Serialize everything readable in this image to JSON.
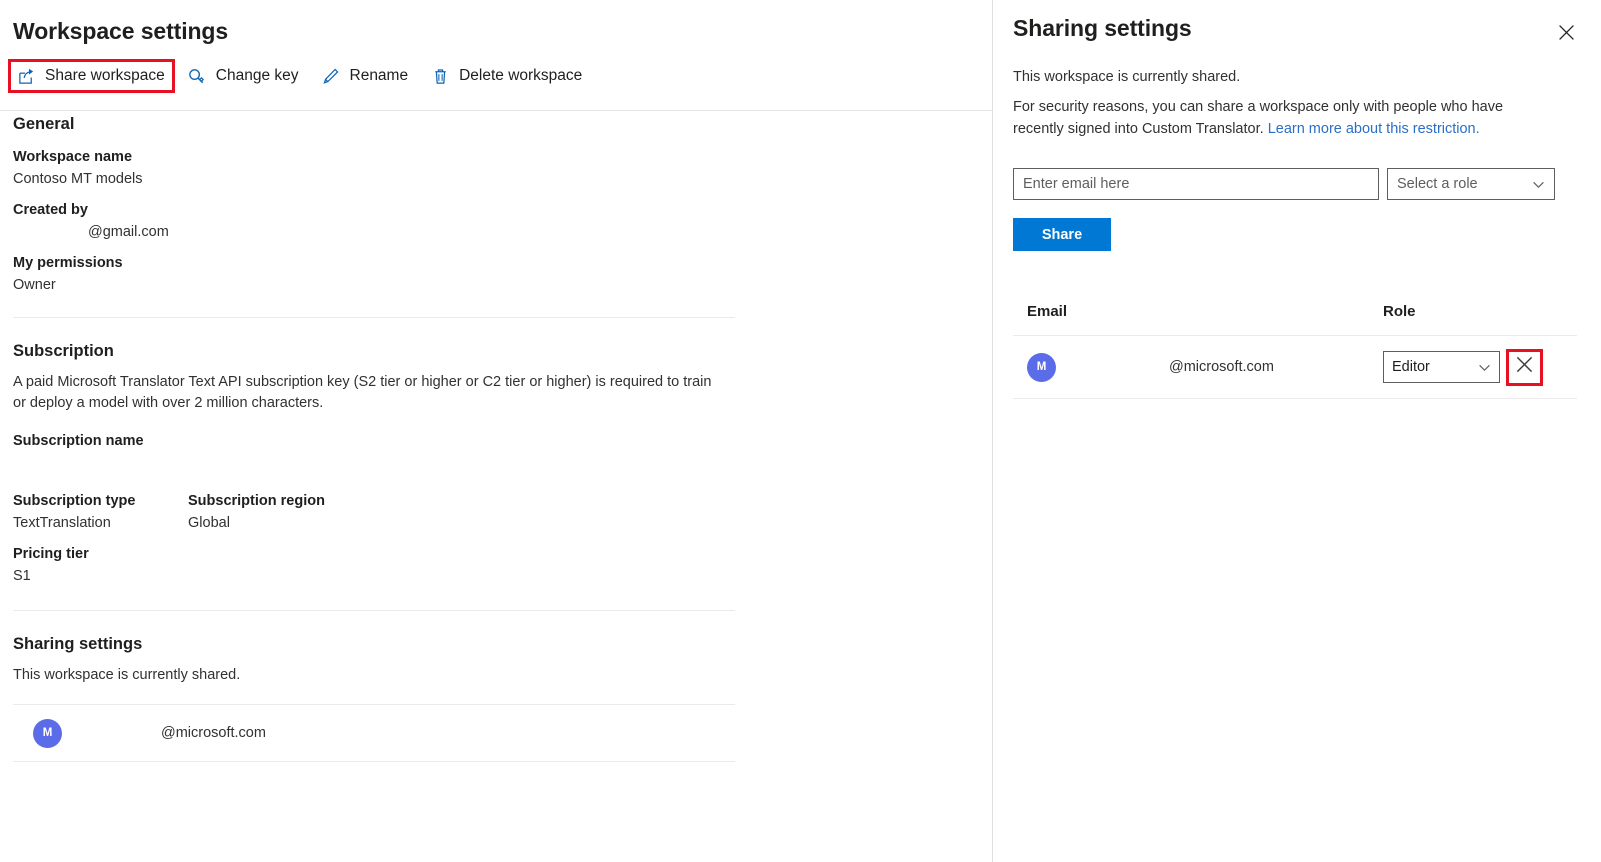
{
  "left": {
    "page_title": "Workspace settings",
    "toolbar": [
      {
        "label": "Share workspace",
        "icon": "share-icon",
        "highlighted": true
      },
      {
        "label": "Change key",
        "icon": "key-icon",
        "highlighted": false
      },
      {
        "label": "Rename",
        "icon": "pencil-icon",
        "highlighted": false
      },
      {
        "label": "Delete workspace",
        "icon": "trash-icon",
        "highlighted": false
      }
    ],
    "general": {
      "title": "General",
      "workspace_name_label": "Workspace name",
      "workspace_name_value": "Contoso MT models",
      "created_by_label": "Created by",
      "created_by_value": "@gmail.com",
      "my_permissions_label": "My permissions",
      "my_permissions_value": "Owner"
    },
    "subscription": {
      "title": "Subscription",
      "description": "A paid Microsoft Translator Text API subscription key (S2 tier or higher or C2 tier or higher) is required to train or deploy a model with over 2 million characters.",
      "name_label": "Subscription name",
      "name_value": "",
      "type_label": "Subscription type",
      "type_value": "TextTranslation",
      "region_label": "Subscription region",
      "region_value": "Global",
      "pricing_label": "Pricing tier",
      "pricing_value": "S1"
    },
    "sharing": {
      "title": "Sharing settings",
      "status": "This workspace is currently shared.",
      "members": [
        {
          "initial": "M",
          "email": "@microsoft.com"
        }
      ]
    }
  },
  "right": {
    "title": "Sharing settings",
    "close_label": "✕",
    "status": "This workspace is currently shared.",
    "security_note_prefix": "For security reasons, you can share a workspace only with people who have recently signed into Custom Translator. ",
    "security_note_link": "Learn more about this restriction.",
    "email_placeholder": "Enter email here",
    "email_value": "",
    "role_placeholder": "Select a role",
    "share_button": "Share",
    "table": {
      "col_email": "Email",
      "col_role": "Role",
      "rows": [
        {
          "initial": "M",
          "email": "@microsoft.com",
          "role": "Editor",
          "remove_label": "✕"
        }
      ]
    }
  },
  "colors": {
    "accent": "#0078d4",
    "highlight": "#e81123",
    "avatar": "#5b6ce8",
    "link": "#2a6fc9",
    "divider": "#e1dfdd"
  }
}
